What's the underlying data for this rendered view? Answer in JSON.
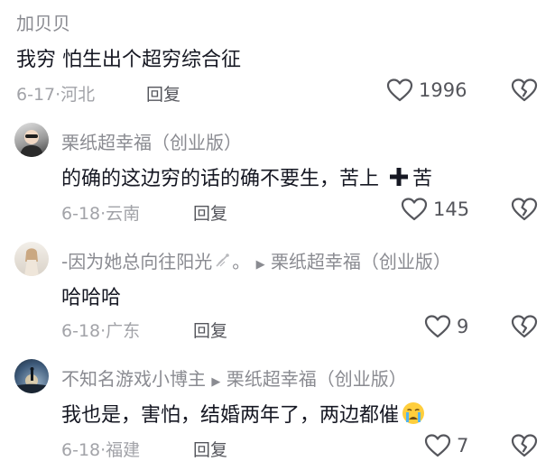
{
  "comments": [
    {
      "author": "加贝贝",
      "text": "我穷 怕生出个超穷综合征",
      "date": "6-17",
      "location": "河北",
      "reply_label": "回复",
      "likes": "1996"
    },
    {
      "author": "栗纸超幸福（创业版）",
      "text": "的确的这边穷的话的确不要生，苦上",
      "text_end": "苦",
      "date": "6-18",
      "location": "云南",
      "reply_label": "回复",
      "likes": "145"
    },
    {
      "author": "-因为她总向往阳光",
      "author_suffix": "。",
      "reply_to": "栗纸超幸福（创业版）",
      "text": "哈哈哈",
      "date": "6-18",
      "location": "广东",
      "reply_label": "回复",
      "likes": "9"
    },
    {
      "author": "不知名游戏小博主",
      "reply_to": "栗纸超幸福（创业版）",
      "text": "我也是，害怕，结婚两年了，两边都催",
      "date": "6-18",
      "location": "福建",
      "reply_label": "回复",
      "likes": "7"
    }
  ],
  "separator": "·",
  "colors": {
    "primary_text": "#161823",
    "secondary_text": "#8a8b91",
    "meta_text": "#a2a3a8"
  },
  "icons": [
    "like-heart-icon",
    "dislike-broken-heart-icon",
    "reply-arrow-icon",
    "plus-cross-emoji-icon",
    "crying-face-emoji-icon"
  ]
}
